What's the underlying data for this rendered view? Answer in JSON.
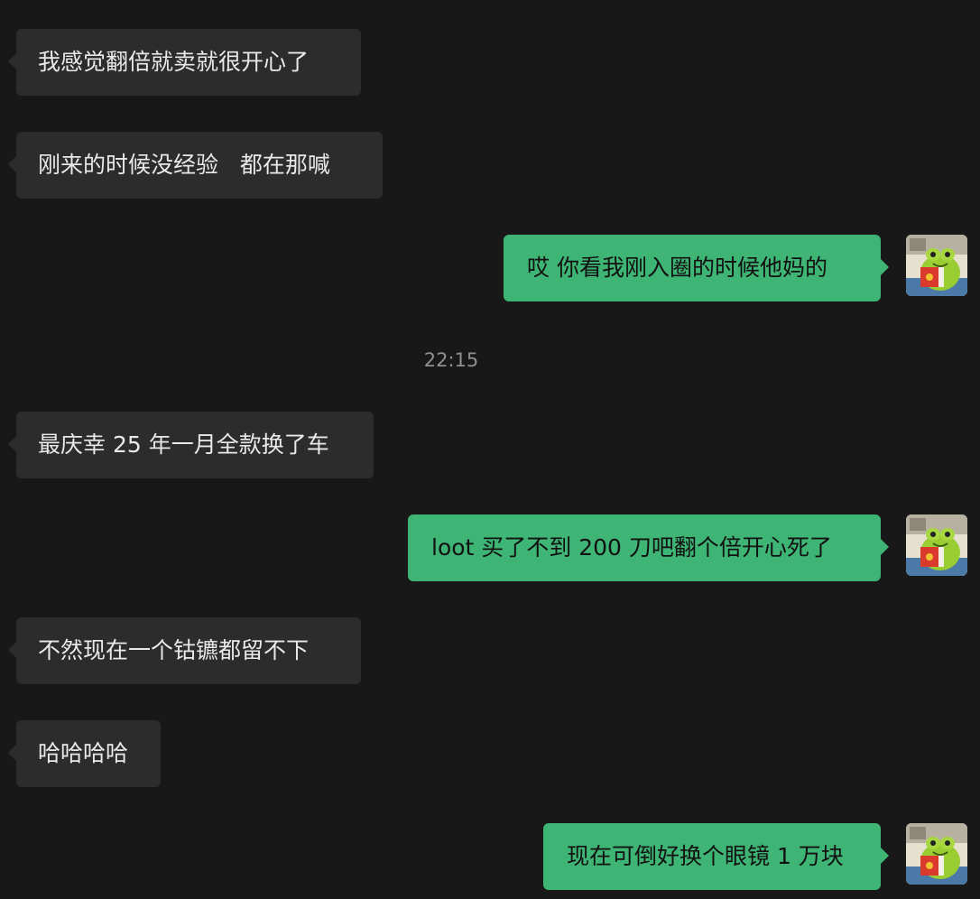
{
  "messages": [
    {
      "side": "in",
      "text": "我感觉翻倍就卖就很开心了"
    },
    {
      "side": "in",
      "text": "刚来的时候没经验   都在那喊"
    },
    {
      "side": "out",
      "text": "哎 你看我刚入圈的时候他妈的"
    },
    {
      "side": "in",
      "text": "最庆幸 25 年一月全款换了车"
    },
    {
      "side": "out",
      "text": "loot 买了不到 200 刀吧翻个倍开心死了"
    },
    {
      "side": "in",
      "text": "不然现在一个钴镳都留不下"
    },
    {
      "side": "in",
      "text": "哈哈哈哈"
    },
    {
      "side": "out",
      "text": "现在可倒好换个眼镜 1 万块"
    }
  ],
  "timestamp": "22:15",
  "avatar_icon": "frog-reading-book-avatar",
  "colors": {
    "background": "#181818",
    "incoming_bubble": "#2c2c2c",
    "outgoing_bubble": "#3eb575",
    "timestamp_text": "#8f8f8f"
  }
}
